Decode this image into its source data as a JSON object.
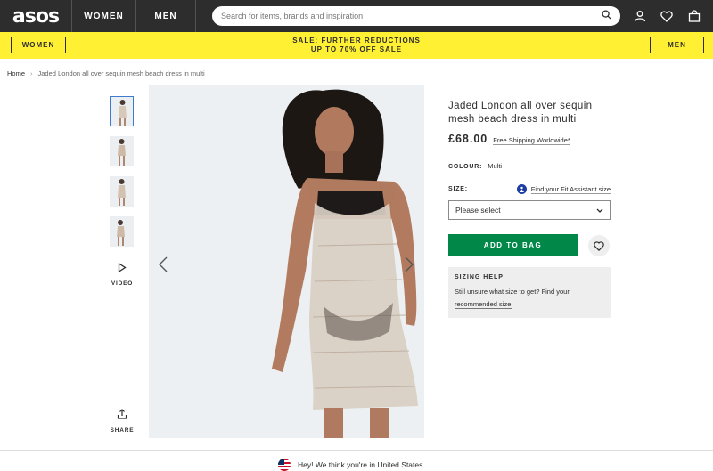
{
  "header": {
    "logo": "asos",
    "nav": [
      "WOMEN",
      "MEN"
    ],
    "search_placeholder": "Search for items, brands and inspiration",
    "icons": [
      "search-icon",
      "account-icon",
      "heart-icon",
      "bag-icon"
    ]
  },
  "sale_bar": {
    "left_button": "WOMEN",
    "right_button": "MEN",
    "line1": "SALE: FURTHER REDUCTIONS",
    "line2": "UP TO 70% OFF SALE"
  },
  "breadcrumb": {
    "home": "Home",
    "separator": "›",
    "current": "Jaded London all over sequin mesh beach dress in multi"
  },
  "gallery": {
    "video_label": "VIDEO",
    "share_label": "SHARE"
  },
  "product": {
    "title": "Jaded London all over sequin mesh beach dress in multi",
    "price": "£68.00",
    "shipping": "Free Shipping Worldwide*",
    "colour_label": "COLOUR:",
    "colour_value": "Multi",
    "size_label": "SIZE:",
    "fit_assistant": "Find your Fit Assistant size",
    "size_select": "Please select",
    "add_to_bag": "ADD TO BAG",
    "sizing_help_title": "SIZING HELP",
    "sizing_help_text": "Still unsure what size to get?",
    "sizing_help_link": "Find your recommended size."
  },
  "geo_banner": {
    "text": "Hey! We think you're in United States"
  },
  "colors": {
    "header_bg": "#2d2d2d",
    "sale_bg": "#fff033",
    "add_to_bag": "#018849",
    "accent": "#3f7ad1"
  }
}
